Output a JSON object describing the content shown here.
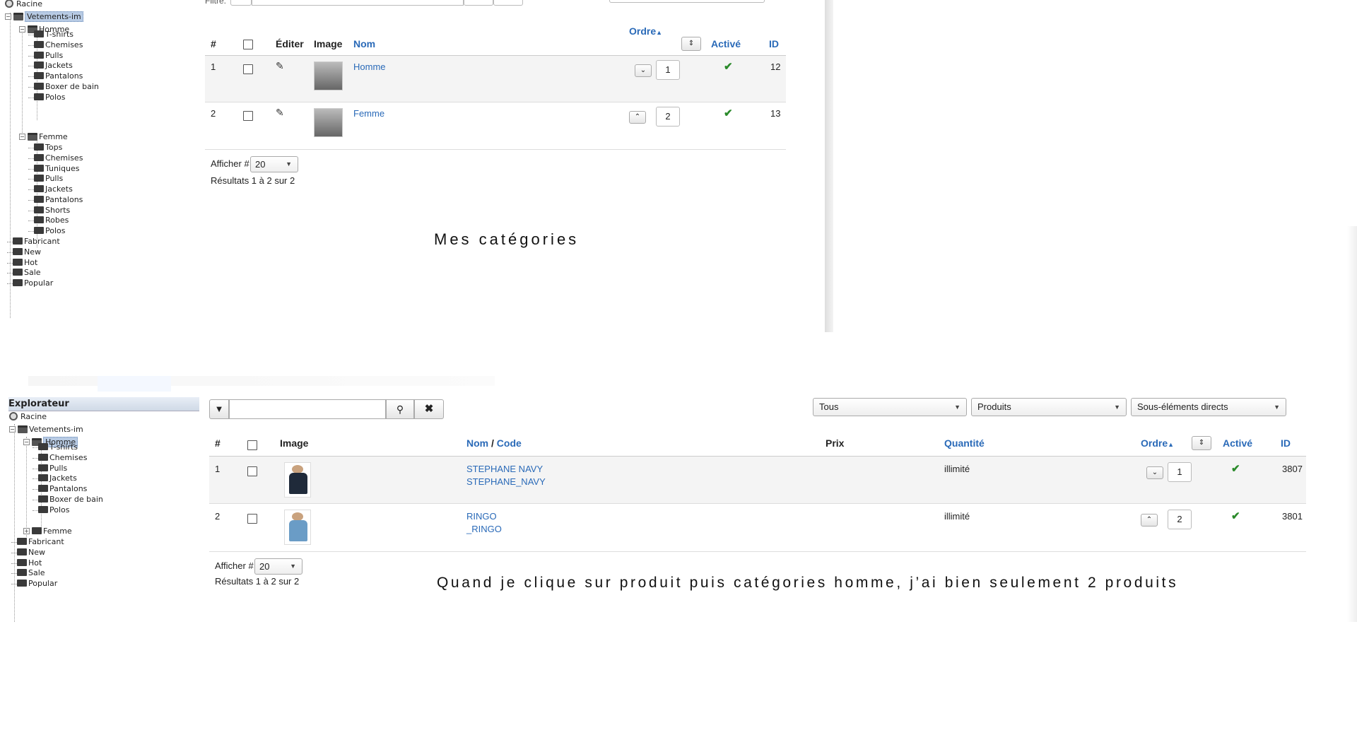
{
  "top_panel": {
    "filter_label": "Filtre:",
    "tree": {
      "root": "Racine",
      "store": "Vetements-im",
      "homme": "Homme",
      "homme_children": [
        "T-shirts",
        "Chemises",
        "Pulls",
        "Jackets",
        "Pantalons",
        "Boxer de bain",
        "Polos"
      ],
      "femme": "Femme",
      "femme_children": [
        "Tops",
        "Chemises",
        "Tuniques",
        "Pulls",
        "Jackets",
        "Pantalons",
        "Shorts",
        "Robes",
        "Polos"
      ],
      "others": [
        "Fabricant",
        "New",
        "Hot",
        "Sale",
        "Popular"
      ]
    },
    "headers": {
      "num": "#",
      "edit": "Éditer",
      "image": "Image",
      "name": "Nom",
      "order": "Ordre",
      "active": "Activé",
      "id": "ID"
    },
    "rows": [
      {
        "num": "1",
        "name": "Homme",
        "order": "1",
        "id": "12"
      },
      {
        "num": "2",
        "name": "Femme",
        "order": "2",
        "id": "13"
      }
    ],
    "show_label": "Afficher #",
    "show_value": "20",
    "results": "Résultats 1 à 2 sur 2",
    "caption": "Mes catégories"
  },
  "bottom_panel": {
    "explorer_title": "Explorateur",
    "tree": {
      "root": "Racine",
      "store": "Vetements-im",
      "homme": "Homme",
      "homme_children": [
        "T-shirts",
        "Chemises",
        "Pulls",
        "Jackets",
        "Pantalons",
        "Boxer de bain",
        "Polos"
      ],
      "femme": "Femme",
      "others": [
        "Fabricant",
        "New",
        "Hot",
        "Sale",
        "Popular"
      ]
    },
    "filters": {
      "all": "Tous",
      "products": "Produits",
      "scope": "Sous-éléments directs"
    },
    "headers": {
      "num": "#",
      "image": "Image",
      "name": "Nom",
      "slash": " / ",
      "code": "Code",
      "price": "Prix",
      "quantity": "Quantité",
      "order": "Ordre",
      "active": "Activé",
      "id": "ID"
    },
    "rows": [
      {
        "num": "1",
        "name": "STEPHANE NAVY",
        "code": "STEPHANE_NAVY",
        "quantity": "illimité",
        "order": "1",
        "id": "3807"
      },
      {
        "num": "2",
        "name": "RINGO",
        "code": "_RINGO",
        "quantity": "illimité",
        "order": "2",
        "id": "3801"
      }
    ],
    "show_label": "Afficher #",
    "show_value": "20",
    "results": "Résultats 1 à 2 sur 2",
    "caption": "Quand je clique sur produit puis catégories homme, j’ai bien seulement 2 produits"
  },
  "colors": {
    "link": "#2a6ab8",
    "check": "#2a8a2a",
    "selected": "#b8cbe4"
  }
}
